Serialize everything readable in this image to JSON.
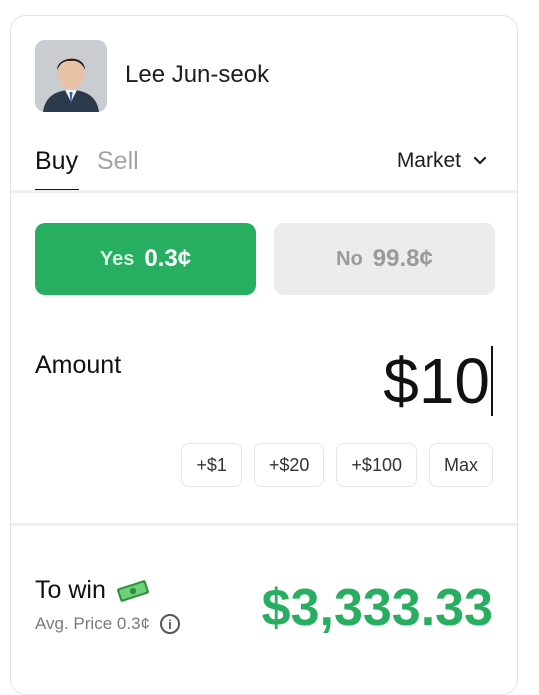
{
  "market": {
    "candidate_name": "Lee Jun-seok"
  },
  "tabs": {
    "buy": "Buy",
    "sell": "Sell"
  },
  "order_type": {
    "selected": "Market"
  },
  "outcomes": {
    "yes": {
      "label": "Yes",
      "price": "0.3¢"
    },
    "no": {
      "label": "No",
      "price": "99.8¢"
    }
  },
  "amount": {
    "label": "Amount",
    "value": "$10"
  },
  "quick_add": [
    "+$1",
    "+$20",
    "+$100",
    "Max"
  ],
  "summary": {
    "to_win_label": "To win",
    "avg_price": "Avg. Price 0.3¢",
    "payout": "$3,333.33"
  },
  "colors": {
    "accent_green": "#27ae60",
    "muted_gray": "#ececec"
  },
  "icons": [
    "chevron-down-icon",
    "money-icon",
    "info-icon"
  ]
}
